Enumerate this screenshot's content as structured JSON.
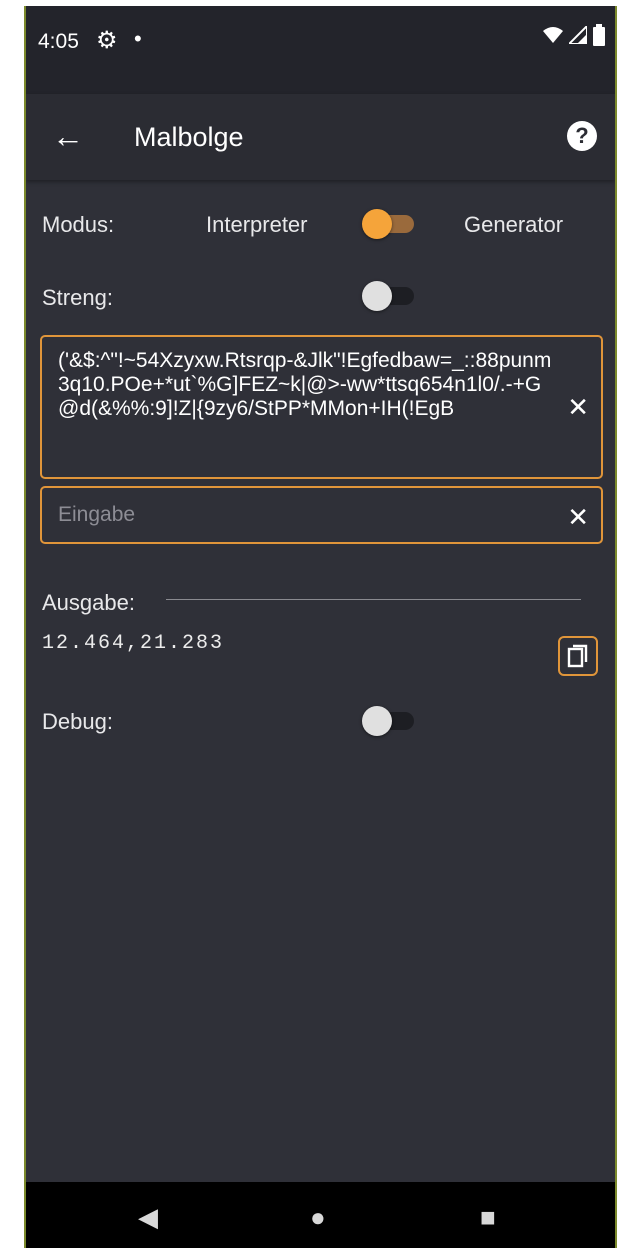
{
  "status_bar": {
    "time": "4:05"
  },
  "app_bar": {
    "title": "Malbolge"
  },
  "mode": {
    "label": "Modus:",
    "option_left": "Interpreter",
    "option_right": "Generator",
    "toggle_on": true
  },
  "strict": {
    "label": "Streng:",
    "toggle_on": false
  },
  "code_field": {
    "value": "('&$:^\"!~54Xzyxw.Rtsrqp-&Jlk\"!Egfedbaw=_::88punm3q10.POe+*ut`%G]FEZ~k|@>-ww*ttsq654n1l0/.-+G@d(&%%:9]!Z|{9zy6/StPP*MMon+IH(!EgB"
  },
  "input_field": {
    "placeholder": "Eingabe",
    "value": ""
  },
  "output": {
    "label": "Ausgabe:",
    "value": "12.464,21.283"
  },
  "debug": {
    "label": "Debug:",
    "toggle_on": false
  },
  "colors": {
    "accent": "#e0953a",
    "background": "#2f3038",
    "toggle_thumb_on": "#f5a43a"
  }
}
